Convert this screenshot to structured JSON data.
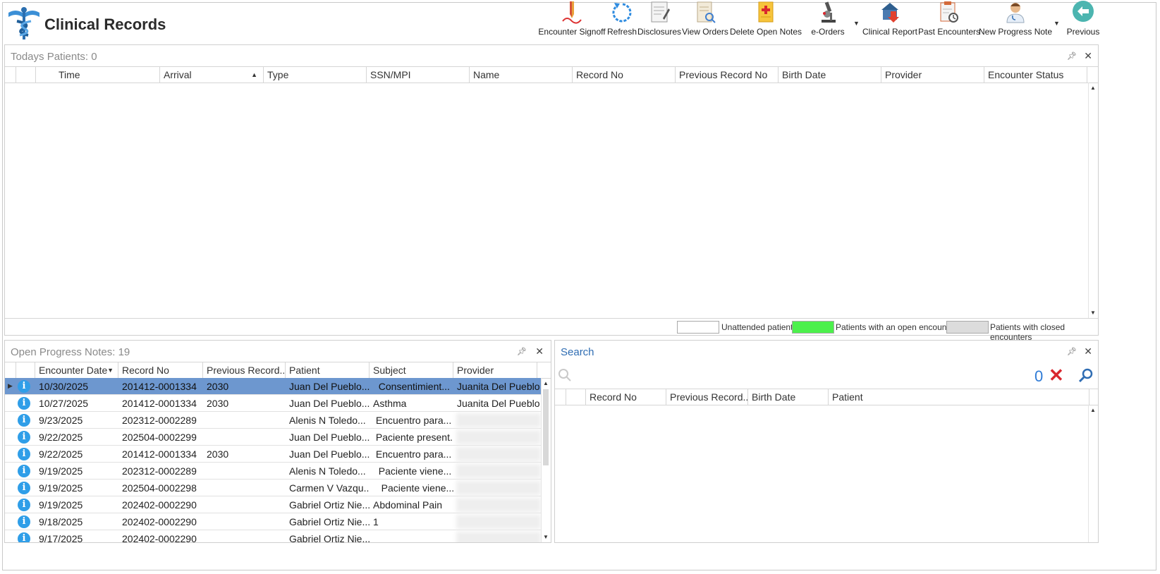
{
  "app": {
    "title": "Clinical Records"
  },
  "toolbar": {
    "encounter_signoff": "Encounter Signoff",
    "refresh": "Refresh",
    "disclosures": "Disclosures",
    "view_orders": "View Orders",
    "delete_open_notes": "Delete Open Notes",
    "e_orders": "e-Orders",
    "clinical_report": "Clinical Report",
    "past_encounters": "Past Encounters",
    "new_progress_note": "New Progress Note",
    "previous": "Previous"
  },
  "todays": {
    "title": "Todays Patients:",
    "count": "0",
    "columns": [
      "Time",
      "Arrival",
      "Type",
      "SSN/MPI",
      "Name",
      "Record No",
      "Previous Record No",
      "Birth Date",
      "Provider",
      "Encounter Status"
    ],
    "sort_column": "Arrival"
  },
  "legend": {
    "unattended": "Unattended patients",
    "open": "Patients with an open encounter",
    "closed": "Patients with closed encounters",
    "colors": {
      "unattended": "#ffffff",
      "open": "#4cf04c",
      "closed": "#dcdcdc"
    }
  },
  "notes": {
    "title": "Open Progress Notes:",
    "count": "19",
    "columns": [
      "Encounter Date",
      "Record No",
      "Previous Record...",
      "Patient",
      "Subject",
      "Provider"
    ],
    "rows": [
      {
        "date": "10/30/2025",
        "record": "201412-0001334",
        "prev": "2030",
        "patient": "Juan Del Pueblo...",
        "subject": "  Consentimient...",
        "provider": "Juanita Del Pueblo",
        "selected": true
      },
      {
        "date": "10/27/2025",
        "record": "201412-0001334",
        "prev": "2030",
        "patient": "Juan Del Pueblo...",
        "subject": "Asthma",
        "provider": "Juanita Del Pueblo"
      },
      {
        "date": "9/23/2025",
        "record": "202312-0002289",
        "prev": "",
        "patient": "Alenis N Toledo...",
        "subject": " Encuentro para...",
        "provider": ""
      },
      {
        "date": "9/22/2025",
        "record": "202504-0002299",
        "prev": "",
        "patient": "Juan Del Pueblo...",
        "subject": " Paciente present...",
        "provider": ""
      },
      {
        "date": "9/22/2025",
        "record": "201412-0001334",
        "prev": "2030",
        "patient": "Juan Del Pueblo...",
        "subject": " Encuentro para...",
        "provider": ""
      },
      {
        "date": "9/19/2025",
        "record": "202312-0002289",
        "prev": "",
        "patient": "Alenis N Toledo...",
        "subject": "  Paciente viene...",
        "provider": ""
      },
      {
        "date": "9/19/2025",
        "record": "202504-0002298",
        "prev": "",
        "patient": "Carmen V Vazqu...",
        "subject": "   Paciente viene...",
        "provider": ""
      },
      {
        "date": "9/19/2025",
        "record": "202402-0002290",
        "prev": "",
        "patient": "Gabriel Ortiz Nie...",
        "subject": "Abdominal Pain",
        "provider": ""
      },
      {
        "date": "9/18/2025",
        "record": "202402-0002290",
        "prev": "",
        "patient": "Gabriel Ortiz Nie...",
        "subject": "1",
        "provider": ""
      },
      {
        "date": "9/17/2025",
        "record": "202402-0002290",
        "prev": "",
        "patient": "Gabriel Ortiz Nie...",
        "subject": "",
        "provider": ""
      }
    ]
  },
  "search": {
    "title": "Search",
    "count": "0",
    "columns": [
      "Record No",
      "Previous Record...",
      "Birth Date",
      "Patient"
    ]
  }
}
